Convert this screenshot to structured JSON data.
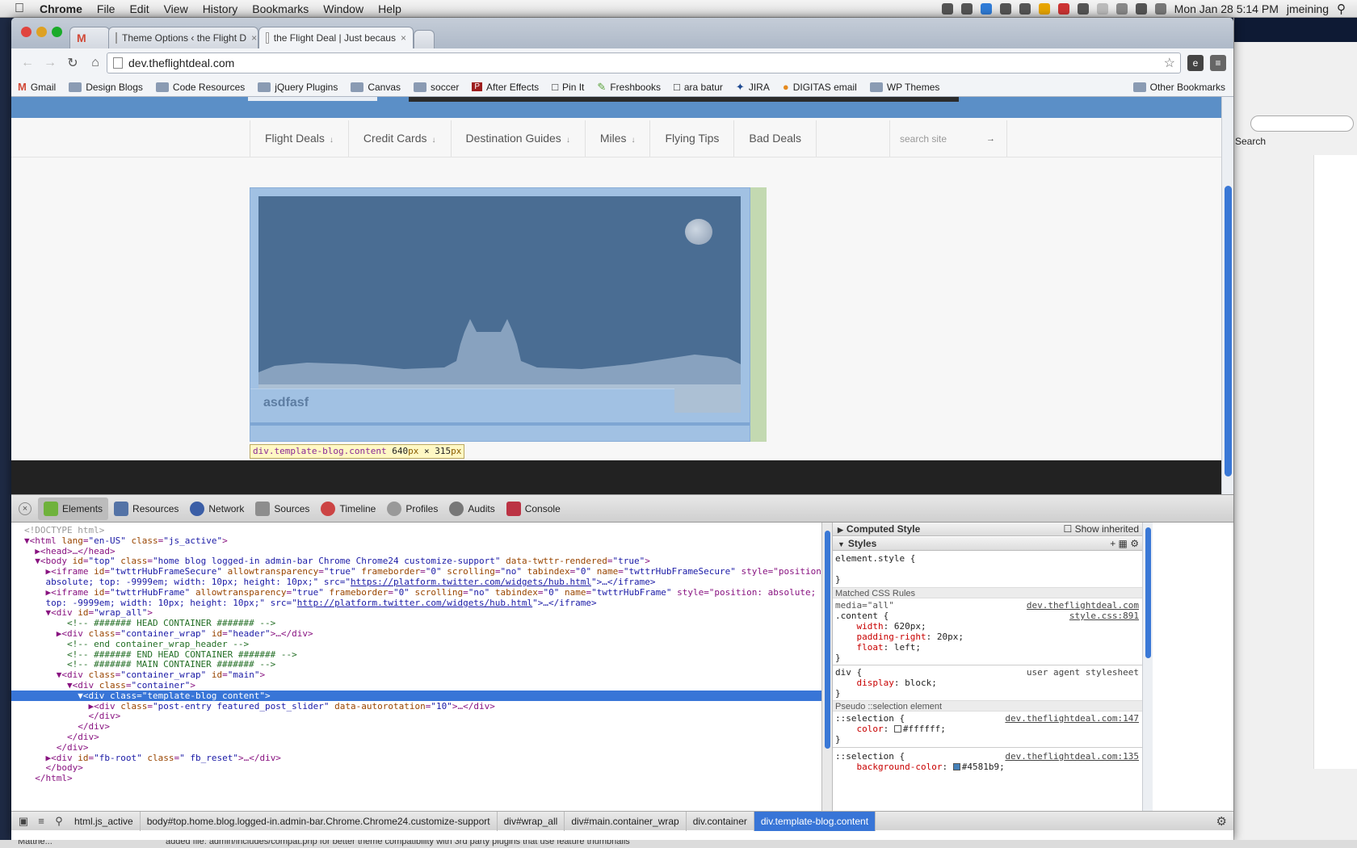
{
  "menubar": {
    "app": "Chrome",
    "items": [
      "File",
      "Edit",
      "View",
      "History",
      "Bookmarks",
      "Window",
      "Help"
    ],
    "clock": "Mon Jan 28  5:14 PM",
    "user": "jmeining"
  },
  "tabs": [
    {
      "label": "",
      "icon": "gmail-icon"
    },
    {
      "label": "Theme Options ‹ the Flight D",
      "close": "×"
    },
    {
      "label": "the Flight Deal | Just becaus",
      "close": "×"
    }
  ],
  "address": {
    "url": "dev.theflightdeal.com"
  },
  "bookmarks": [
    {
      "label": "Gmail",
      "icon": "gmail-icon"
    },
    {
      "label": "Design Blogs",
      "icon": "folder-icon"
    },
    {
      "label": "Code Resources",
      "icon": "folder-icon"
    },
    {
      "label": "jQuery Plugins",
      "icon": "folder-icon"
    },
    {
      "label": "Canvas",
      "icon": "folder-icon"
    },
    {
      "label": "soccer",
      "icon": "folder-icon"
    },
    {
      "label": "After Effects",
      "icon": "after-effects-icon"
    },
    {
      "label": "Pin It",
      "icon": "page-icon"
    },
    {
      "label": "Freshbooks",
      "icon": "freshbooks-icon"
    },
    {
      "label": "ara batur",
      "icon": "page-icon"
    },
    {
      "label": "JIRA",
      "icon": "jira-icon"
    },
    {
      "label": "DIGITAS email",
      "icon": "digitas-icon"
    },
    {
      "label": "WP Themes",
      "icon": "folder-icon"
    }
  ],
  "other_bookmarks": "Other Bookmarks",
  "site": {
    "nav": [
      {
        "label": "Flight Deals",
        "dropdown": true
      },
      {
        "label": "Credit Cards",
        "dropdown": true
      },
      {
        "label": "Destination Guides",
        "dropdown": true
      },
      {
        "label": "Miles",
        "dropdown": true
      },
      {
        "label": "Flying Tips",
        "dropdown": false
      },
      {
        "label": "Bad Deals",
        "dropdown": false
      }
    ],
    "arrow": "↓",
    "search_placeholder": "search site",
    "search_go": "→",
    "slide_caption": "asdfasf"
  },
  "highlight_tooltip": {
    "tag": "div.template-blog.content",
    "width": "640",
    "height": "315",
    "unit": "px",
    "times": "×"
  },
  "devtools": {
    "tabs": [
      "Elements",
      "Resources",
      "Network",
      "Sources",
      "Timeline",
      "Profiles",
      "Audits",
      "Console"
    ],
    "active_tab": "Elements",
    "dom_lines": [
      "<!DOCTYPE html>",
      "▼<html lang=\"en-US\" class=\"js_active\">",
      "  ▶<head>…</head>",
      "  ▼<body id=\"top\" class=\"home blog logged-in admin-bar Chrome Chrome24 customize-support\" data-twttr-rendered=\"true\">",
      "    ▶<iframe id=\"twttrHubFrameSecure\" allowtransparency=\"true\" frameborder=\"0\" scrolling=\"no\" tabindex=\"0\" name=\"twttrHubFrameSecure\" style=\"position:",
      "    absolute; top: -9999em; width: 10px; height: 10px;\" src=\"https://platform.twitter.com/widgets/hub.html\">…</iframe>",
      "    ▶<iframe id=\"twttrHubFrame\" allowtransparency=\"true\" frameborder=\"0\" scrolling=\"no\" tabindex=\"0\" name=\"twttrHubFrame\" style=\"position: absolute;",
      "    top: -9999em; width: 10px; height: 10px;\" src=\"http://platform.twitter.com/widgets/hub.html\">…</iframe>",
      "    ▼<div id=\"wrap_all\">",
      "        <!-- ####### HEAD CONTAINER ####### -->",
      "      ▶<div class=\"container_wrap\" id=\"header\">…</div>",
      "        <!-- end container_wrap_header -->",
      "        <!-- ####### END HEAD CONTAINER ####### -->",
      "        <!-- ####### MAIN CONTAINER ####### -->",
      "      ▼<div class=\"container_wrap\" id=\"main\">",
      "        ▼<div class=\"container\">",
      "          ▼<div class=\"template-blog content\">",
      "            ▶<div class=\"post-entry featured_post_slider\" data-autorotation=\"10\">…</div>",
      "            </div>",
      "          </div>",
      "        </div>",
      "      </div>",
      "    ▶<div id=\"fb-root\" class=\" fb_reset\">…</div>",
      "    </body>",
      "  </html>"
    ],
    "selected_line": 16,
    "styles": {
      "computed": "Computed Style",
      "show_inherited": "Show inherited",
      "styles_header": "Styles",
      "element_style_open": "element.style {",
      "element_style_close": "}",
      "matched_header": "Matched CSS Rules",
      "rule1_media": "media=\"all\"",
      "rule1_source": "dev.theflightdeal.com",
      "rule1_selector": ".content {",
      "rule1_file": "style.css:891",
      "rule1_props": [
        {
          "name": "width",
          "value": "620px;"
        },
        {
          "name": "padding-right",
          "value": "20px;"
        },
        {
          "name": "float",
          "value": "left;"
        }
      ],
      "rule1_close": "}",
      "rule2_selector": "div {",
      "rule2_source": "user agent stylesheet",
      "rule2_props": [
        {
          "name": "display",
          "value": "block;"
        }
      ],
      "rule2_close": "}",
      "pseudo_header": "Pseudo ::selection element",
      "rule3_selector": "::selection {",
      "rule3_source": "dev.theflightdeal.com:147",
      "rule3_prop": "color",
      "rule3_value": "#ffffff;",
      "rule3_close": "}",
      "rule4_selector": "::selection {",
      "rule4_source": "dev.theflightdeal.com:135",
      "rule4_prop": "background-color",
      "rule4_value": "#4581b9;"
    },
    "breadcrumbs": [
      "html.js_active",
      "body#top.home.blog.logged-in.admin-bar.Chrome.Chrome24.customize-support",
      "div#wrap_all",
      "div#main.container_wrap",
      "div.container",
      "div.template-blog.content"
    ]
  },
  "background": {
    "search_label": "Search",
    "status_text": "added file: admin/includes/compat.php for better theme compatibility with 3rd party plugins that use feature thumbnails",
    "dock_label": "Matthe..."
  },
  "colors": {
    "selection": "#3875d7",
    "swatch_white": "#ffffff",
    "swatch_blue": "#4581b9"
  }
}
